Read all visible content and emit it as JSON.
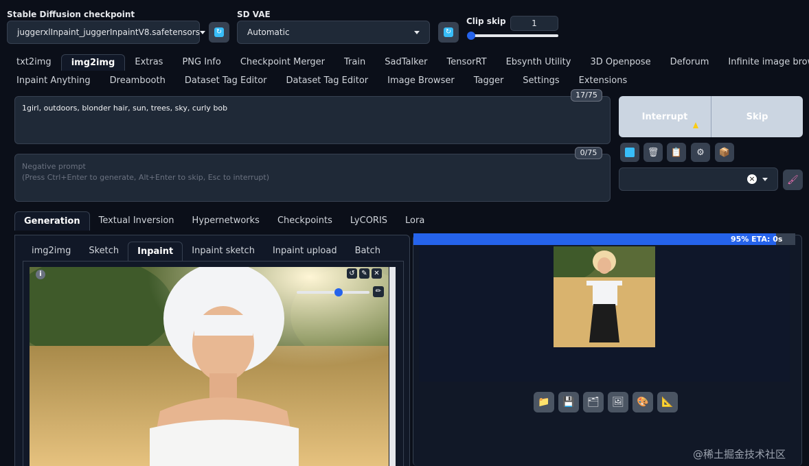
{
  "settings": {
    "checkpoint_label": "Stable Diffusion checkpoint",
    "checkpoint_value": "juggerxlInpaint_juggerInpaintV8.safetensors",
    "vae_label": "SD VAE",
    "vae_value": "Automatic",
    "clip_label": "Clip skip",
    "clip_value": "1",
    "clip_slider_fraction": 0
  },
  "main_tabs_row1": [
    "txt2img",
    "img2img",
    "Extras",
    "PNG Info",
    "Checkpoint Merger",
    "Train",
    "SadTalker",
    "TensorRT",
    "Ebsynth Utility",
    "3D Openpose",
    "Deforum",
    "Infinite image browsing"
  ],
  "main_tabs_row2": [
    "Inpaint Anything",
    "Dreambooth",
    "Dataset Tag Editor",
    "Dataset Tag Editor",
    "Image Browser",
    "Tagger",
    "Settings",
    "Extensions"
  ],
  "active_main_tab": "img2img",
  "prompt": {
    "text": "1girl, outdoors, blonder hair, sun, trees, sky, curly bob",
    "counter": "17/75"
  },
  "negative": {
    "placeholder_line1": "Negative prompt",
    "placeholder_line2": "(Press Ctrl+Enter to generate, Alt+Enter to skip, Esc to interrupt)",
    "counter": "0/75"
  },
  "actions": {
    "interrupt": "Interrupt",
    "skip": "Skip"
  },
  "tool_icons": [
    "paste-icon",
    "trash-icon",
    "clipboard-icon",
    "sliders-icon",
    "box-icon"
  ],
  "style_clear": "×",
  "gen_tabs": [
    "Generation",
    "Textual Inversion",
    "Hypernetworks",
    "Checkpoints",
    "LyCORIS",
    "Lora"
  ],
  "active_gen_tab": "Generation",
  "img_tabs": [
    "img2img",
    "Sketch",
    "Inpaint",
    "Inpaint sketch",
    "Inpaint upload",
    "Batch"
  ],
  "active_img_tab": "Inpaint",
  "canvas": {
    "info": "i",
    "brush_fraction": 0.58
  },
  "progress": {
    "fraction": 0.95,
    "text": "95% ETA: 0s"
  },
  "gallery_icons": [
    "folder-icon",
    "save-icon",
    "zip-icon",
    "image-icon",
    "palette-icon",
    "ruler-icon"
  ],
  "watermark": "@稀土掘金技术社区",
  "colors": {
    "accent": "#2563eb",
    "background": "#0b0f19",
    "panel": "#1f2937"
  }
}
